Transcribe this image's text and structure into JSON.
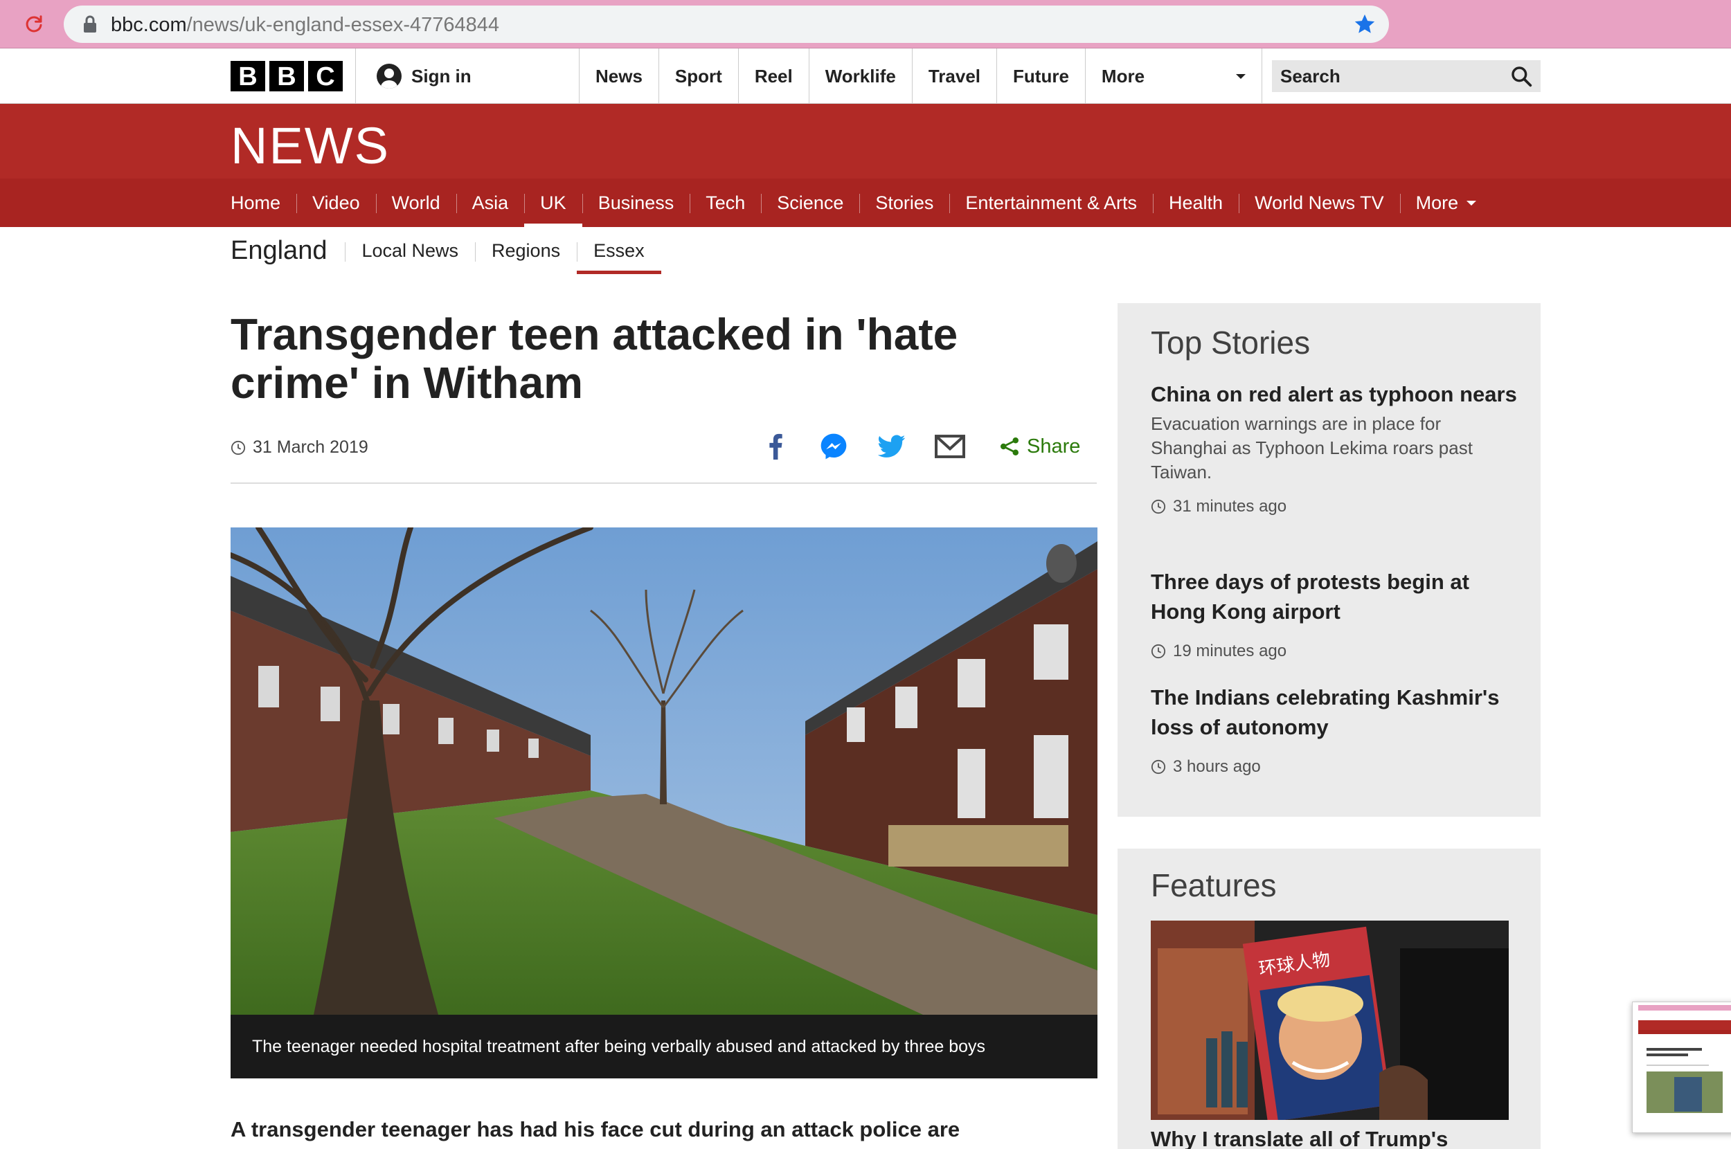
{
  "browser": {
    "url_host": "bbc.com",
    "url_path": "/news/uk-england-essex-47764844",
    "star_color": "#1a73e8"
  },
  "bbc_bar": {
    "logo_letters": [
      "B",
      "B",
      "C"
    ],
    "sign_in": "Sign in",
    "nav": [
      "News",
      "Sport",
      "Reel",
      "Worklife",
      "Travel",
      "Future"
    ],
    "more": "More",
    "search_placeholder": "Search"
  },
  "news_band": {
    "logo": "NEWS",
    "color": "#b12a26"
  },
  "section_nav": {
    "items": [
      "Home",
      "Video",
      "World",
      "Asia",
      "UK",
      "Business",
      "Tech",
      "Science",
      "Stories",
      "Entertainment & Arts",
      "Health",
      "World News TV"
    ],
    "active": "UK",
    "more": "More"
  },
  "sub_nav": {
    "region": "England",
    "items": [
      "Local News",
      "Regions",
      "Essex"
    ],
    "active": "Essex"
  },
  "article": {
    "headline": "Transgender teen attacked in 'hate crime' in Witham",
    "date": "31 March 2019",
    "share_label": "Share",
    "image_caption": "The teenager needed hospital treatment after being verbally abused and attacked by three boys",
    "lead": "A transgender teenager has had his face cut during an attack police are"
  },
  "top_stories": {
    "title": "Top Stories",
    "items": [
      {
        "title": "China on red alert as typhoon nears",
        "summary": "Evacuation warnings are in place for Shanghai as Typhoon Lekima roars past Taiwan.",
        "time": "31 minutes ago"
      },
      {
        "title": "Three days of protests begin at Hong Kong airport",
        "summary": "",
        "time": "19 minutes ago"
      },
      {
        "title": "The Indians celebrating Kashmir's loss of autonomy",
        "summary": "",
        "time": "3 hours ago"
      }
    ]
  },
  "features": {
    "title": "Features",
    "item_title": "Why I translate all of Trump's",
    "image_text": "环球人物"
  }
}
